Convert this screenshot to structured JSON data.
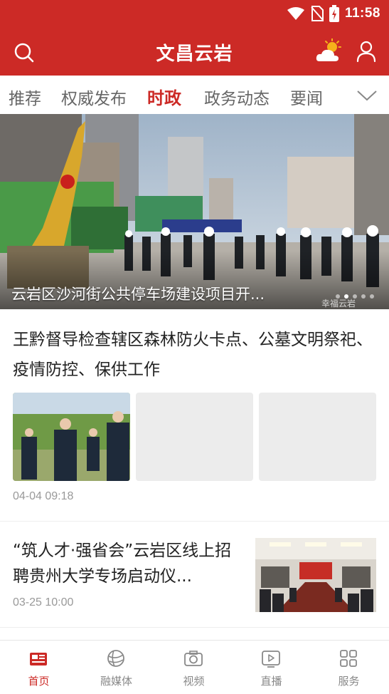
{
  "status_bar": {
    "time": "11:58"
  },
  "header": {
    "title": "文昌云岩",
    "icons": [
      "search-icon",
      "weather-icon",
      "user-icon"
    ]
  },
  "tabs": {
    "items": [
      "推荐",
      "权威发布",
      "时政",
      "政务动态",
      "要闻"
    ],
    "active": "时政"
  },
  "banner": {
    "caption": "云岩区沙河街公共停车场建设项目开...",
    "watermark": "幸福云岩",
    "page_count": 5,
    "active_page": 2
  },
  "articles": [
    {
      "title": "王黔督导检查辖区森林防火卡点、公墓文明祭祀、疫情防控、保供工作",
      "time": "04-04 09:18"
    },
    {
      "title": "“筑人才·强省会”云岩区线上招聘贵州大学专场启动仪...",
      "time": "03-25 10:00"
    }
  ],
  "bottom_nav": [
    {
      "label": "首页",
      "icon": "newspaper-icon"
    },
    {
      "label": "融媒体",
      "icon": "globe-icon"
    },
    {
      "label": "视频",
      "icon": "camera-icon"
    },
    {
      "label": "直播",
      "icon": "play-icon"
    },
    {
      "label": "服务",
      "icon": "grid-icon"
    }
  ],
  "colors": {
    "brand": "#cc2a26",
    "inactive": "#888888"
  }
}
